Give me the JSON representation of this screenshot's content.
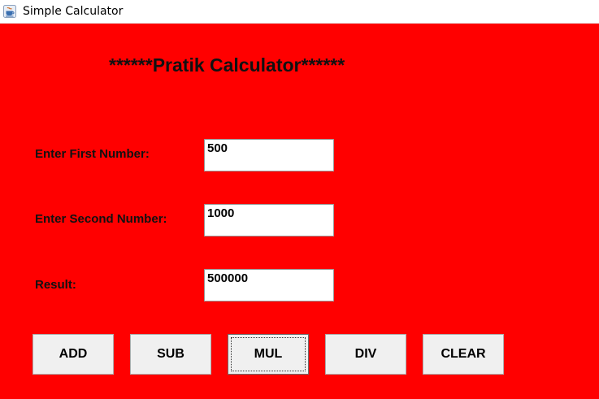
{
  "window": {
    "title": "Simple Calculator",
    "icon": "java-coffee-cup-icon",
    "background_color": "#ff0000"
  },
  "heading": "******Pratik Calculator******",
  "fields": {
    "first": {
      "label": "Enter First Number:",
      "value": "500"
    },
    "second": {
      "label": "Enter Second Number:",
      "value": "1000"
    },
    "result": {
      "label": "Result:",
      "value": "500000"
    }
  },
  "buttons": {
    "add": "ADD",
    "sub": "SUB",
    "mul": "MUL",
    "div": "DIV",
    "clear": "CLEAR"
  }
}
